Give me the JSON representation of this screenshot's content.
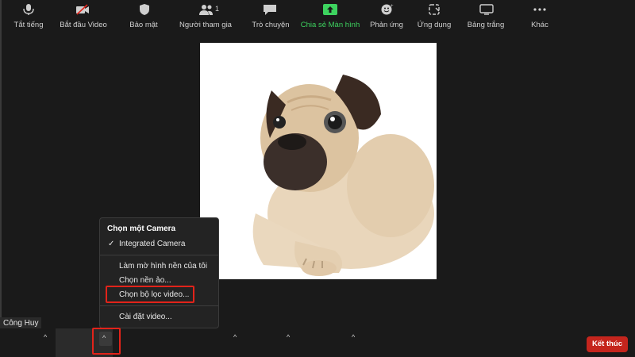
{
  "participant": {
    "name": "Công Huy"
  },
  "camera_menu": {
    "header": "Chọn một Camera",
    "selected_camera": "Integrated Camera",
    "items": [
      "Làm mờ hình nền của tôi",
      "Chọn nền ảo...",
      "Chọn bộ lọc video...",
      "Cài đặt video..."
    ]
  },
  "toolbar": {
    "mute": "Tắt tiếng",
    "start_video": "Bắt đầu Video",
    "security": "Bảo mật",
    "participants": "Người tham gia",
    "participants_count": "1",
    "chat": "Trò chuyện",
    "share_screen": "Chia sẻ Màn hình",
    "reactions": "Phản ứng",
    "apps": "Ứng dụng",
    "whiteboard": "Bảng trắng",
    "more": "Khác",
    "end": "Kết thúc"
  },
  "colors": {
    "background": "#1a1a1a",
    "share_green": "#3dd35f",
    "end_red": "#c5251d",
    "highlight_red": "#e2231a"
  }
}
